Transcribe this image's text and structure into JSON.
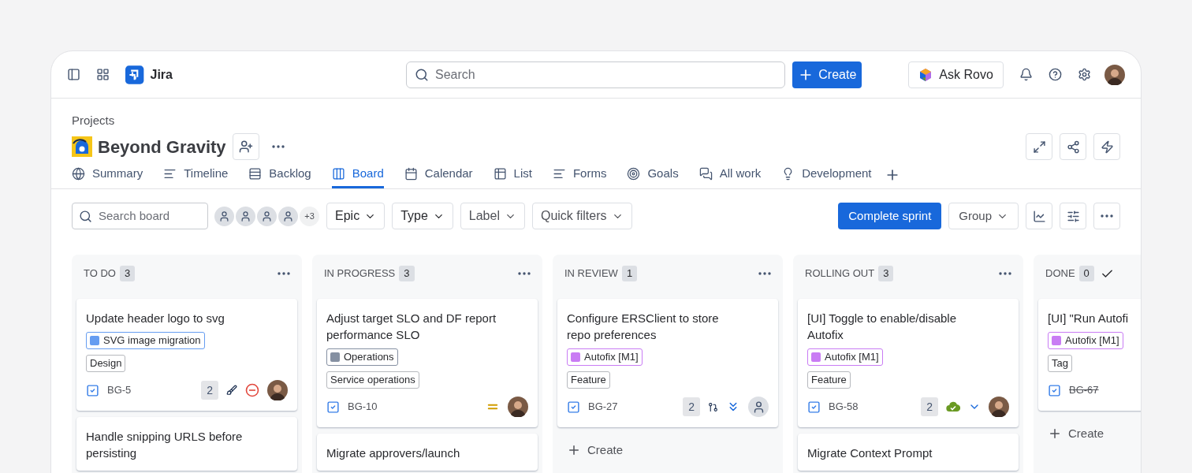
{
  "topbar": {
    "product": "Jira",
    "search": {
      "placeholder": "Search"
    },
    "create": "Create",
    "ask": "Ask Rovo"
  },
  "project": {
    "breadcrumb": "Projects",
    "name": "Beyond Gravity"
  },
  "tabs": [
    {
      "label": "Summary",
      "selected": false
    },
    {
      "label": "Timeline",
      "selected": false
    },
    {
      "label": "Backlog",
      "selected": false
    },
    {
      "label": "Board",
      "selected": true
    },
    {
      "label": "Calendar",
      "selected": false
    },
    {
      "label": "List",
      "selected": false
    },
    {
      "label": "Forms",
      "selected": false
    },
    {
      "label": "Goals",
      "selected": false
    },
    {
      "label": "All work",
      "selected": false
    },
    {
      "label": "Development",
      "selected": false
    }
  ],
  "toolbar": {
    "search": {
      "placeholder": "Search board"
    },
    "more_people": "+3",
    "filters": [
      {
        "label": "Epic",
        "active": true
      },
      {
        "label": "Type",
        "active": true
      },
      {
        "label": "Label",
        "active": false
      },
      {
        "label": "Quick filters",
        "active": false
      }
    ],
    "complete": "Complete sprint",
    "group": "Group"
  },
  "columns": [
    {
      "title": "TO DO",
      "count": "3",
      "kind": "active",
      "cards": [
        {
          "title": "Update header logo to svg",
          "epic": {
            "label": "SVG image migration",
            "color": "#669df1"
          },
          "labels": [
            "Design"
          ],
          "key": "BG-5",
          "done": false,
          "footer": [
            {
              "kind": "count",
              "text": "2"
            },
            {
              "kind": "brush"
            },
            {
              "kind": "blocked"
            }
          ],
          "assignee": {
            "kind": "photo"
          }
        },
        {
          "title": "Handle snipping URLS before persisting"
        }
      ]
    },
    {
      "title": "IN PROGRESS",
      "count": "3",
      "kind": "active",
      "cards": [
        {
          "title": "Adjust target SLO and DF report performance SLO",
          "epic": {
            "label": "Operations",
            "color": "#8590a2"
          },
          "labels": [
            "Service operations"
          ],
          "key": "BG-10",
          "done": false,
          "footer": [
            {
              "kind": "medium"
            }
          ],
          "assignee": {
            "kind": "photo"
          }
        },
        {
          "title": "Migrate approvers/launch"
        }
      ]
    },
    {
      "title": "IN REVIEW",
      "count": "1",
      "kind": "active",
      "cards": [
        {
          "title": "Configure ERSClient to store repo preferences",
          "epic": {
            "label": "Autofix [M1]",
            "color": "#c97cf4"
          },
          "labels": [
            "Feature"
          ],
          "key": "BG-27",
          "done": false,
          "footer": [
            {
              "kind": "count",
              "text": "2"
            },
            {
              "kind": "pullrequest"
            },
            {
              "kind": "lowest"
            }
          ],
          "assignee": {
            "kind": "none"
          }
        }
      ],
      "create": "Create"
    },
    {
      "title": "ROLLING OUT",
      "count": "3",
      "kind": "active",
      "cards": [
        {
          "title": "[UI] Toggle to enable/disable Autofix",
          "epic": {
            "label": "Autofix [M1]",
            "color": "#c97cf4"
          },
          "labels": [
            "Feature"
          ],
          "key": "BG-58",
          "done": false,
          "footer": [
            {
              "kind": "count",
              "text": "2"
            },
            {
              "kind": "deployed"
            },
            {
              "kind": "low"
            }
          ],
          "assignee": {
            "kind": "photo"
          }
        },
        {
          "title": "Migrate Context Prompt"
        }
      ]
    },
    {
      "title": "DONE",
      "count": "0",
      "kind": "done",
      "cards": [
        {
          "title": "[UI] \"Run Autofi",
          "epic": {
            "label": "Autofix [M1]",
            "color": "#c97cf4"
          },
          "labels": [
            "Tag"
          ],
          "key": "BG-67",
          "done": true
        }
      ],
      "create": "Create"
    }
  ]
}
